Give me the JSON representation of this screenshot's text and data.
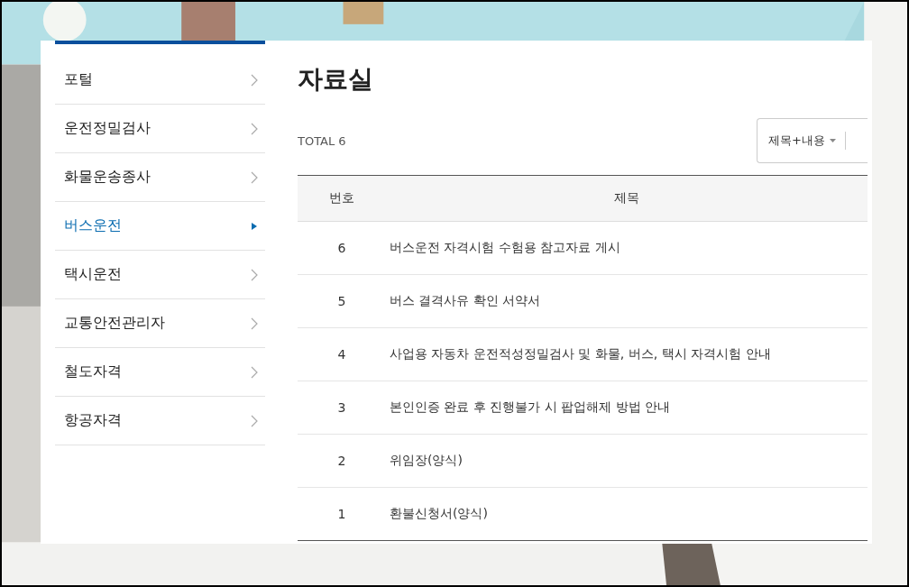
{
  "sidebar": {
    "items": [
      {
        "label": "포털",
        "selected": false
      },
      {
        "label": "운전정밀검사",
        "selected": false
      },
      {
        "label": "화물운송종사",
        "selected": false
      },
      {
        "label": "버스운전",
        "selected": true
      },
      {
        "label": "택시운전",
        "selected": false
      },
      {
        "label": "교통안전관리자",
        "selected": false
      },
      {
        "label": "철도자격",
        "selected": false
      },
      {
        "label": "항공자격",
        "selected": false
      }
    ]
  },
  "page_title": "자료실",
  "total": "TOTAL 6",
  "search": {
    "scope": "제목+내용"
  },
  "table": {
    "columns": [
      "번호",
      "제목"
    ],
    "rows": [
      {
        "number": "6",
        "title": "버스운전 자격시험 수험용 참고자료 게시"
      },
      {
        "number": "5",
        "title": "버스 결격사유 확인 서약서"
      },
      {
        "number": "4",
        "title": "사업용 자동차 운전적성정밀검사 및 화물, 버스, 택시 자격시험 안내"
      },
      {
        "number": "3",
        "title": "본인인증 완료 후 진행불가 시 팝업해제 방법 안내"
      },
      {
        "number": "2",
        "title": "위임장(양식)"
      },
      {
        "number": "1",
        "title": "환불신청서(양식)"
      }
    ]
  }
}
